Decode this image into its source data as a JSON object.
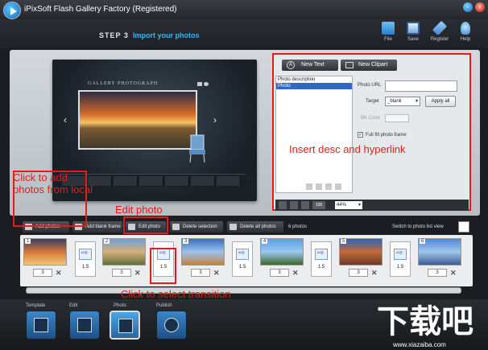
{
  "window": {
    "title": "iPixSoft Flash Gallery Factory (Registered)",
    "min_label": "-",
    "close_label": "x"
  },
  "header": {
    "step_label": "STEP 3",
    "step_title": "Import your photos",
    "buttons": [
      {
        "label": "File",
        "icon": "folder-icon"
      },
      {
        "label": "Save",
        "icon": "save-icon"
      },
      {
        "label": "Register",
        "icon": "wrench-icon"
      },
      {
        "label": "Help",
        "icon": "lightbulb-icon"
      }
    ]
  },
  "preview": {
    "gallery_title": "GALLERY PHOTOGRAPH",
    "prev_arrow": "‹",
    "next_arrow": "›"
  },
  "right_panel": {
    "new_text_label": "New Text",
    "new_clipart_label": "New Clipart",
    "list_items": [
      "Photo description",
      "Photo"
    ],
    "selected_index": 1,
    "photo_url_label": "Photo URL",
    "photo_url_value": "",
    "target_label": "Target",
    "target_value": "_blank",
    "apply_all_label": "Apply all",
    "bk_color_label": "BK Color",
    "full_fill_label": "Full fill photo frame",
    "full_fill_checked": true,
    "zoom_value": "44%",
    "zoom_100_label": "100"
  },
  "annotations": {
    "insert_desc": "Insert desc and hyperlink",
    "add_photos": "Click to add photos from local",
    "edit_photo": "Edit photo",
    "select_transition": "Click to select transition"
  },
  "toolbar": {
    "add_photos": "Add photos",
    "add_blank_frame": "Add blank frame",
    "edit_photo": "Edit photo",
    "delete_selection": "Delete selection",
    "delete_all_photos": "Delete all photos",
    "photo_count": "6 photos",
    "switch_view": "Switch to photo list view"
  },
  "timeline": {
    "photos": [
      {
        "num": "1",
        "duration": "3",
        "colors": [
          "#3a3e63",
          "#d3773a",
          "#f2c878"
        ]
      },
      {
        "num": "2",
        "duration": "3",
        "colors": [
          "#6f9fd8",
          "#d8b07a",
          "#5e6e3a"
        ]
      },
      {
        "num": "3",
        "duration": "3",
        "colors": [
          "#3c6fb8",
          "#9cc2ee",
          "#c08040"
        ]
      },
      {
        "num": "4",
        "duration": "3",
        "colors": [
          "#5fa0e0",
          "#9ac8f0",
          "#3c6a2c"
        ]
      },
      {
        "num": "5",
        "duration": "3",
        "colors": [
          "#2b66b4",
          "#c46a3a",
          "#6d3b26"
        ]
      },
      {
        "num": "6",
        "duration": "3",
        "colors": [
          "#4e88d4",
          "#a2c7ec",
          "#3b5d92"
        ]
      }
    ],
    "transitions": [
      "1.5",
      "1.5",
      "1.5",
      "1.5",
      "1.5"
    ]
  },
  "bottom_nav": [
    {
      "label": "Template",
      "icon": "template-icon",
      "active": false
    },
    {
      "label": "Edit",
      "icon": "edit-icon",
      "active": false
    },
    {
      "label": "Photo",
      "icon": "photo-icon",
      "active": true
    },
    {
      "label": "Publish",
      "icon": "publish-icon",
      "active": false
    }
  ],
  "watermark": {
    "logo_text": "下载吧",
    "url": "www.xiazaiba.com"
  },
  "colors": {
    "accent_blue": "#3fb6f0",
    "annotation_red": "#e31b1b"
  }
}
